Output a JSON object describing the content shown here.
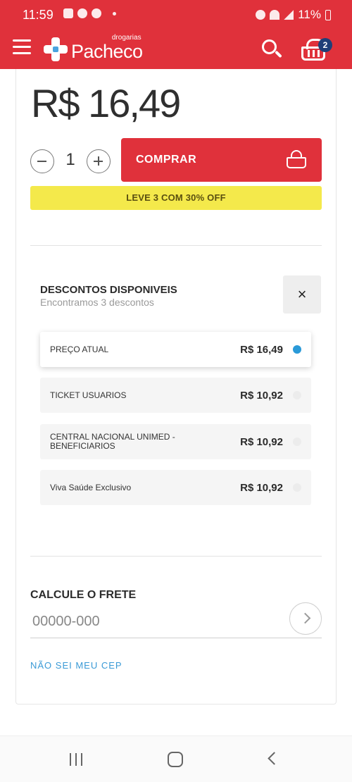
{
  "status_bar": {
    "time": "11:59",
    "battery": "11%"
  },
  "header": {
    "brand": "Pacheco",
    "brand_tag": "drogarias",
    "cart_count": "2"
  },
  "product": {
    "price": "R$ 16,49",
    "quantity": "1",
    "buy_label": "COMPRAR",
    "promo": "LEVE 3 COM 30% OFF"
  },
  "discounts": {
    "title": "DESCONTOS DISPONIVEIS",
    "subtitle": "Encontramos 3 descontos",
    "close": "×",
    "options": [
      {
        "name": "PREÇO ATUAL",
        "price": "R$ 16,49",
        "selected": true
      },
      {
        "name": "TICKET USUARIOS",
        "price": "R$ 10,92",
        "selected": false
      },
      {
        "name": "CENTRAL NACIONAL UNIMED - BENEFICIARIOS",
        "price": "R$ 10,92",
        "selected": false
      },
      {
        "name": "Viva Saúde Exclusivo",
        "price": "R$ 10,92",
        "selected": false
      }
    ]
  },
  "shipping": {
    "title": "CALCULE O FRETE",
    "cep_placeholder": "00000-000",
    "cep_value": "",
    "unknown_cep_link": "NÃO SEI MEU CEP"
  },
  "colors": {
    "brand_red": "#e0313b",
    "promo_yellow": "#f4e94b",
    "link_blue": "#3a9ad6",
    "radio_selected": "#2a9ad8",
    "badge_navy": "#1f3f78"
  },
  "icons": [
    "menu-icon",
    "search-icon",
    "cart-icon",
    "minus-icon",
    "plus-icon",
    "basket-icon",
    "close-icon",
    "chevron-right-icon",
    "recent-apps-icon",
    "home-icon",
    "back-icon"
  ]
}
